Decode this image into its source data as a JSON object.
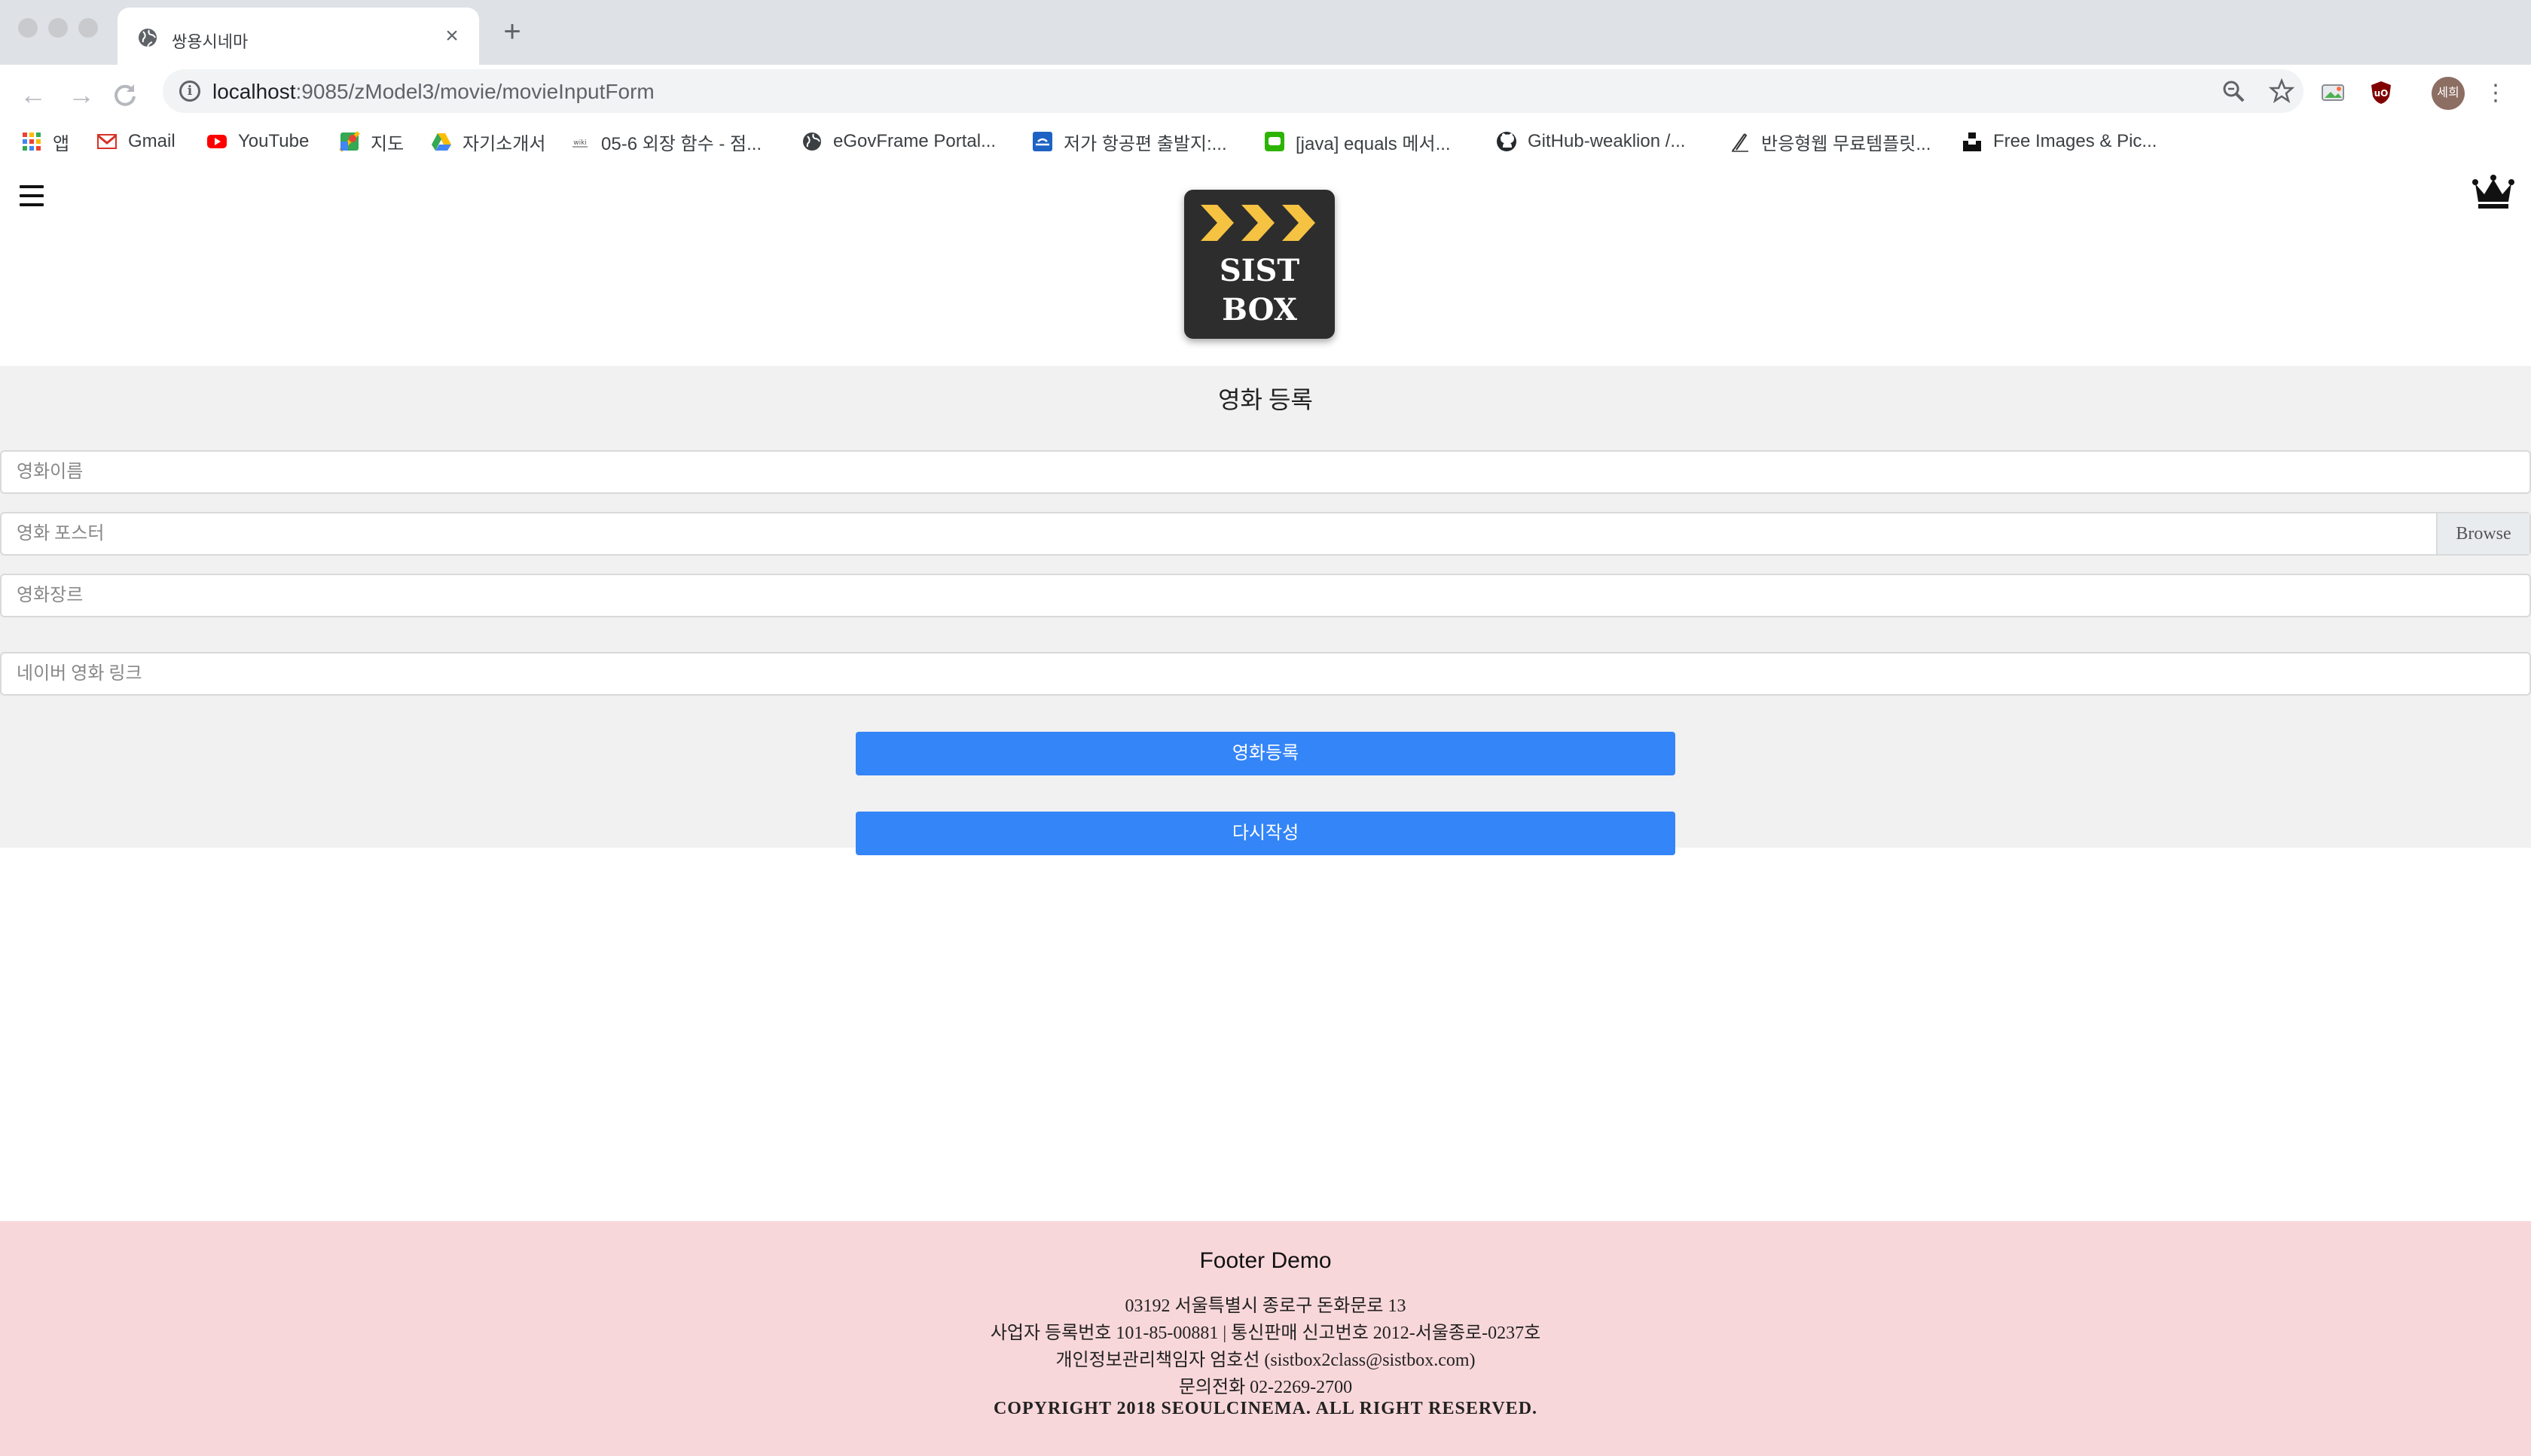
{
  "browser": {
    "tab_title": "쌍용시네마",
    "url_host": "localhost",
    "url_path": ":9085/zModel3/movie/movieInputForm",
    "profile_initials": "세희",
    "bookmarks": [
      {
        "label": "앱",
        "icon": "apps-grid-icon"
      },
      {
        "label": "Gmail",
        "icon": "gmail-icon"
      },
      {
        "label": "YouTube",
        "icon": "youtube-icon"
      },
      {
        "label": "지도",
        "icon": "maps-icon"
      },
      {
        "label": "자기소개서",
        "icon": "drive-icon"
      },
      {
        "label": "05-6 외장 함수 - 점...",
        "icon": "wikidocs-icon"
      },
      {
        "label": "eGovFrame Portal...",
        "icon": "globe-icon"
      },
      {
        "label": "저가 항공편 출발지:...",
        "icon": "flight-icon"
      },
      {
        "label": "[java] equals 메서...",
        "icon": "chat-icon"
      },
      {
        "label": "GitHub-weaklion /...",
        "icon": "github-icon"
      },
      {
        "label": "반응형웹 무료템플릿...",
        "icon": "pen-icon"
      },
      {
        "label": "Free Images & Pic...",
        "icon": "unsplash-icon"
      }
    ]
  },
  "logo": {
    "line1": "SIST",
    "line2": "BOX"
  },
  "form": {
    "title": "영화 등록",
    "movie_name_placeholder": "영화이름",
    "movie_poster_placeholder": "영화 포스터",
    "browse_label": "Browse",
    "movie_genre_placeholder": "영화장르",
    "naver_link_placeholder": "네이버 영화 링크",
    "submit_label": "영화등록",
    "reset_label": "다시작성"
  },
  "footer": {
    "title": "Footer Demo",
    "address": "03192 서울특별시 종로구 돈화문로 13",
    "business": "사업자 등록번호 101-85-00881 | 통신판매 신고번호 2012-서울종로-0237호",
    "privacy": "개인정보관리책임자 엄호선 (sistbox2class@sistbox.com)",
    "phone": "문의전화 02-2269-2700",
    "copyright": "COPYRIGHT 2018 SEOULCINEMA. ALL RIGHT RESERVED."
  },
  "colors": {
    "primary_button": "#3485f7",
    "footer_bg": "#f8d7da",
    "form_bg": "#f1f1f1",
    "logo_bg": "#2d2d2d",
    "logo_arrows": "#f5c242"
  }
}
